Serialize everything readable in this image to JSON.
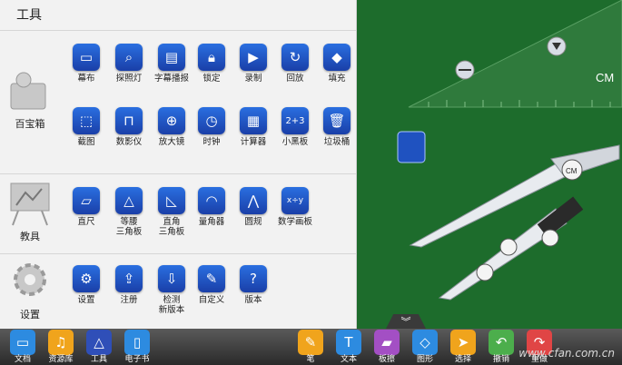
{
  "panel": {
    "title": "工具"
  },
  "sections": [
    {
      "label": "百宝箱",
      "tools": [
        {
          "label": "幕布",
          "icon": "screen-icon"
        },
        {
          "label": "探照灯",
          "icon": "search-icon"
        },
        {
          "label": "字幕播报",
          "icon": "monitor-icon"
        },
        {
          "label": "锁定",
          "icon": "lock-icon"
        },
        {
          "label": "录制",
          "icon": "camera-icon"
        },
        {
          "label": "回放",
          "icon": "replay-icon"
        },
        {
          "label": "填充",
          "icon": "fill-icon"
        },
        {
          "label": "截图",
          "icon": "crop-icon"
        },
        {
          "label": "数影仪",
          "icon": "projector-icon"
        },
        {
          "label": "放大镜",
          "icon": "zoom-icon"
        },
        {
          "label": "时钟",
          "icon": "clock-icon"
        },
        {
          "label": "计算器",
          "icon": "calculator-icon"
        },
        {
          "label": "小黑板",
          "icon": "blackboard-icon"
        },
        {
          "label": "垃圾桶",
          "icon": "trash-icon"
        }
      ]
    },
    {
      "label": "教具",
      "tools": [
        {
          "label": "直尺",
          "icon": "ruler-icon"
        },
        {
          "label": "等腰\n三角板",
          "icon": "isosceles-triangle-icon"
        },
        {
          "label": "直角\n三角板",
          "icon": "right-triangle-icon"
        },
        {
          "label": "量角器",
          "icon": "protractor-icon"
        },
        {
          "label": "圆规",
          "icon": "compass-icon"
        },
        {
          "label": "数学画板",
          "icon": "math-board-icon"
        }
      ]
    },
    {
      "label": "设置",
      "tools": [
        {
          "label": "设置",
          "icon": "gear-icon"
        },
        {
          "label": "注册",
          "icon": "register-icon"
        },
        {
          "label": "检测\n新版本",
          "icon": "download-icon"
        },
        {
          "label": "自定义",
          "icon": "custom-icon"
        },
        {
          "label": "版本",
          "icon": "version-icon"
        }
      ]
    }
  ],
  "board": {
    "ruler_unit": "CM",
    "compass_unit": "CM",
    "float_icon": "math-board-icon"
  },
  "dock": {
    "left": [
      {
        "label": "文档",
        "icon": "folder-icon",
        "color": "#2d8be0"
      },
      {
        "label": "资源库",
        "icon": "resource-icon",
        "color": "#f0a41c"
      },
      {
        "label": "工具",
        "icon": "tools-icon",
        "color": "#2f4fb8"
      },
      {
        "label": "电子书",
        "icon": "book-icon",
        "color": "#2d8be0"
      }
    ],
    "right": [
      {
        "label": "笔",
        "icon": "pen-icon",
        "color": "#f0a41c"
      },
      {
        "label": "文本",
        "icon": "text-icon",
        "color": "#2d8be0"
      },
      {
        "label": "板擦",
        "icon": "eraser-icon",
        "color": "#a34fc4"
      },
      {
        "label": "图形",
        "icon": "shapes-icon",
        "color": "#2d8be0"
      },
      {
        "label": "选择",
        "icon": "cursor-icon",
        "color": "#f0a41c"
      },
      {
        "label": "撤销",
        "icon": "undo-icon",
        "color": "#4cae4c"
      },
      {
        "label": "重做",
        "icon": "redo-icon",
        "color": "#e04545"
      }
    ]
  },
  "watermark": "www.cfan.com.cn"
}
